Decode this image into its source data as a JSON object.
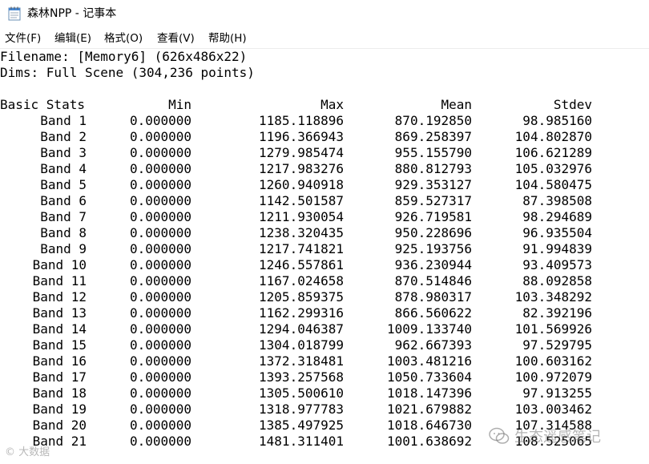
{
  "window": {
    "title": "森林NPP - 记事本"
  },
  "menu": {
    "items": [
      {
        "label": "文件(F)"
      },
      {
        "label": "编辑(E)"
      },
      {
        "label": "格式(O)"
      },
      {
        "label": "查看(V)"
      },
      {
        "label": "帮助(H)"
      }
    ]
  },
  "document": {
    "line_filename": "Filename: [Memory6] (626x486x22)",
    "line_dims": "Dims: Full Scene (304,236 points)",
    "columns": [
      "Basic Stats",
      "Min",
      "Max",
      "Mean",
      "Stdev"
    ],
    "rows": [
      {
        "band": "Band 1",
        "min": "0.000000",
        "max": "1185.118896",
        "mean": "870.192850",
        "stdev": "98.985160"
      },
      {
        "band": "Band 2",
        "min": "0.000000",
        "max": "1196.366943",
        "mean": "869.258397",
        "stdev": "104.802870"
      },
      {
        "band": "Band 3",
        "min": "0.000000",
        "max": "1279.985474",
        "mean": "955.155790",
        "stdev": "106.621289"
      },
      {
        "band": "Band 4",
        "min": "0.000000",
        "max": "1217.983276",
        "mean": "880.812793",
        "stdev": "105.032976"
      },
      {
        "band": "Band 5",
        "min": "0.000000",
        "max": "1260.940918",
        "mean": "929.353127",
        "stdev": "104.580475"
      },
      {
        "band": "Band 6",
        "min": "0.000000",
        "max": "1142.501587",
        "mean": "859.527317",
        "stdev": "87.398508"
      },
      {
        "band": "Band 7",
        "min": "0.000000",
        "max": "1211.930054",
        "mean": "926.719581",
        "stdev": "98.294689"
      },
      {
        "band": "Band 8",
        "min": "0.000000",
        "max": "1238.320435",
        "mean": "950.228696",
        "stdev": "96.935504"
      },
      {
        "band": "Band 9",
        "min": "0.000000",
        "max": "1217.741821",
        "mean": "925.193756",
        "stdev": "91.994839"
      },
      {
        "band": "Band 10",
        "min": "0.000000",
        "max": "1246.557861",
        "mean": "936.230944",
        "stdev": "93.409573"
      },
      {
        "band": "Band 11",
        "min": "0.000000",
        "max": "1167.024658",
        "mean": "870.514846",
        "stdev": "88.092858"
      },
      {
        "band": "Band 12",
        "min": "0.000000",
        "max": "1205.859375",
        "mean": "878.980317",
        "stdev": "103.348292"
      },
      {
        "band": "Band 13",
        "min": "0.000000",
        "max": "1162.299316",
        "mean": "866.560622",
        "stdev": "82.392196"
      },
      {
        "band": "Band 14",
        "min": "0.000000",
        "max": "1294.046387",
        "mean": "1009.133740",
        "stdev": "101.569926"
      },
      {
        "band": "Band 15",
        "min": "0.000000",
        "max": "1304.018799",
        "mean": "962.667393",
        "stdev": "97.529795"
      },
      {
        "band": "Band 16",
        "min": "0.000000",
        "max": "1372.318481",
        "mean": "1003.481216",
        "stdev": "100.603162"
      },
      {
        "band": "Band 17",
        "min": "0.000000",
        "max": "1393.257568",
        "mean": "1050.733604",
        "stdev": "100.972079"
      },
      {
        "band": "Band 18",
        "min": "0.000000",
        "max": "1305.500610",
        "mean": "1018.147396",
        "stdev": "97.913255"
      },
      {
        "band": "Band 19",
        "min": "0.000000",
        "max": "1318.977783",
        "mean": "1021.679882",
        "stdev": "103.003462"
      },
      {
        "band": "Band 20",
        "min": "0.000000",
        "max": "1385.497925",
        "mean": "1018.646730",
        "stdev": "107.314588"
      },
      {
        "band": "Band 21",
        "min": "0.000000",
        "max": "1481.311401",
        "mean": "1001.638692",
        "stdev": "108.525065"
      }
    ]
  },
  "watermarks": {
    "left": "© 大数据",
    "right": "生态遥感笔记"
  },
  "icons": {
    "app": "notepad-icon",
    "wechat": "wechat-icon"
  }
}
